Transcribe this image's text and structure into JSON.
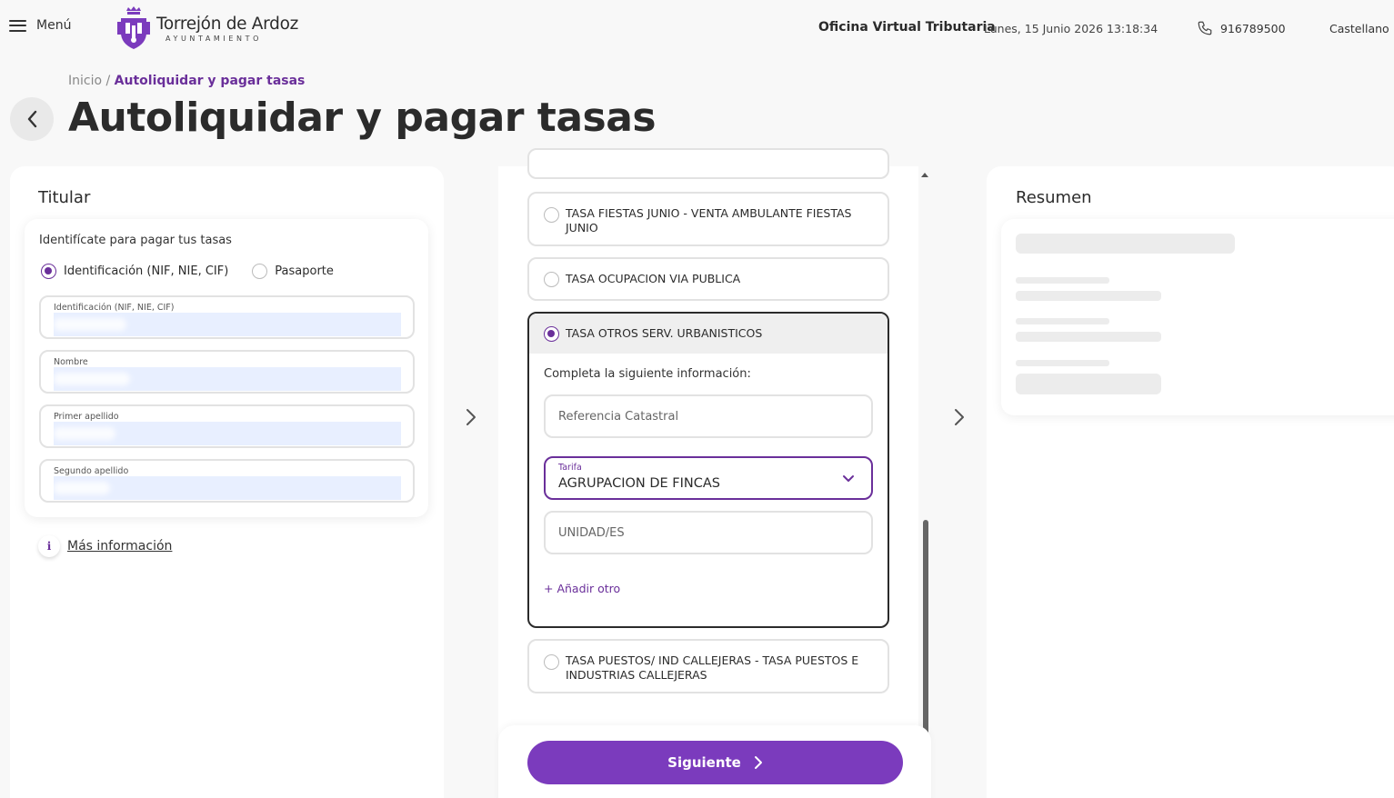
{
  "header": {
    "menu_label": "Menú",
    "logo_name": "Torrejón de Ardoz",
    "logo_sub": "AYUNTAMIENTO",
    "office": "Oficina Virtual Tributaria",
    "datetime": "Lunes, 15 Junio 2026 13:18:34",
    "phone": "916789500",
    "language": "Castellano"
  },
  "breadcrumb": {
    "home": "Inicio",
    "separator": "/",
    "current": "Autoliquidar y pagar tasas"
  },
  "page_title": "Autoliquidar y pagar tasas",
  "titular": {
    "title": "Titular",
    "intro": "Identifícate para pagar tus tasas",
    "id_options": [
      {
        "label": "Identificación (NIF, NIE, CIF)",
        "checked": true
      },
      {
        "label": "Pasaporte",
        "checked": false
      }
    ],
    "fields": [
      {
        "label": "Identificación (NIF, NIE, CIF)"
      },
      {
        "label": "Nombre"
      },
      {
        "label": "Primer apellido"
      },
      {
        "label": "Segundo apellido"
      }
    ],
    "more_info": "Más información"
  },
  "tasas": {
    "options": [
      {
        "label": "TASA FIESTAS JUNIO - VENTA AMBULANTE FIESTAS JUNIO"
      },
      {
        "label": "TASA OCUPACION VIA PUBLICA"
      },
      {
        "label": "TASA OTROS SERV. URBANISTICOS",
        "selected": true
      },
      {
        "label": "TASA PUESTOS/ IND CALLEJERAS - TASA PUESTOS E INDUSTRIAS CALLEJERAS"
      }
    ],
    "selected_form": {
      "intro": "Completa la siguiente información:",
      "referencia_placeholder": "Referencia Catastral",
      "tarifa_label": "Tarifa",
      "tarifa_value": "AGRUPACION DE FINCAS",
      "unidades_placeholder": "UNIDAD/ES",
      "add_other": "+ Añadir otro"
    },
    "next_button": "Siguiente"
  },
  "resumen": {
    "title": "Resumen"
  },
  "colors": {
    "accent": "#6a2f9a",
    "button": "#7b3bbd",
    "autofill": "#e8efff"
  }
}
